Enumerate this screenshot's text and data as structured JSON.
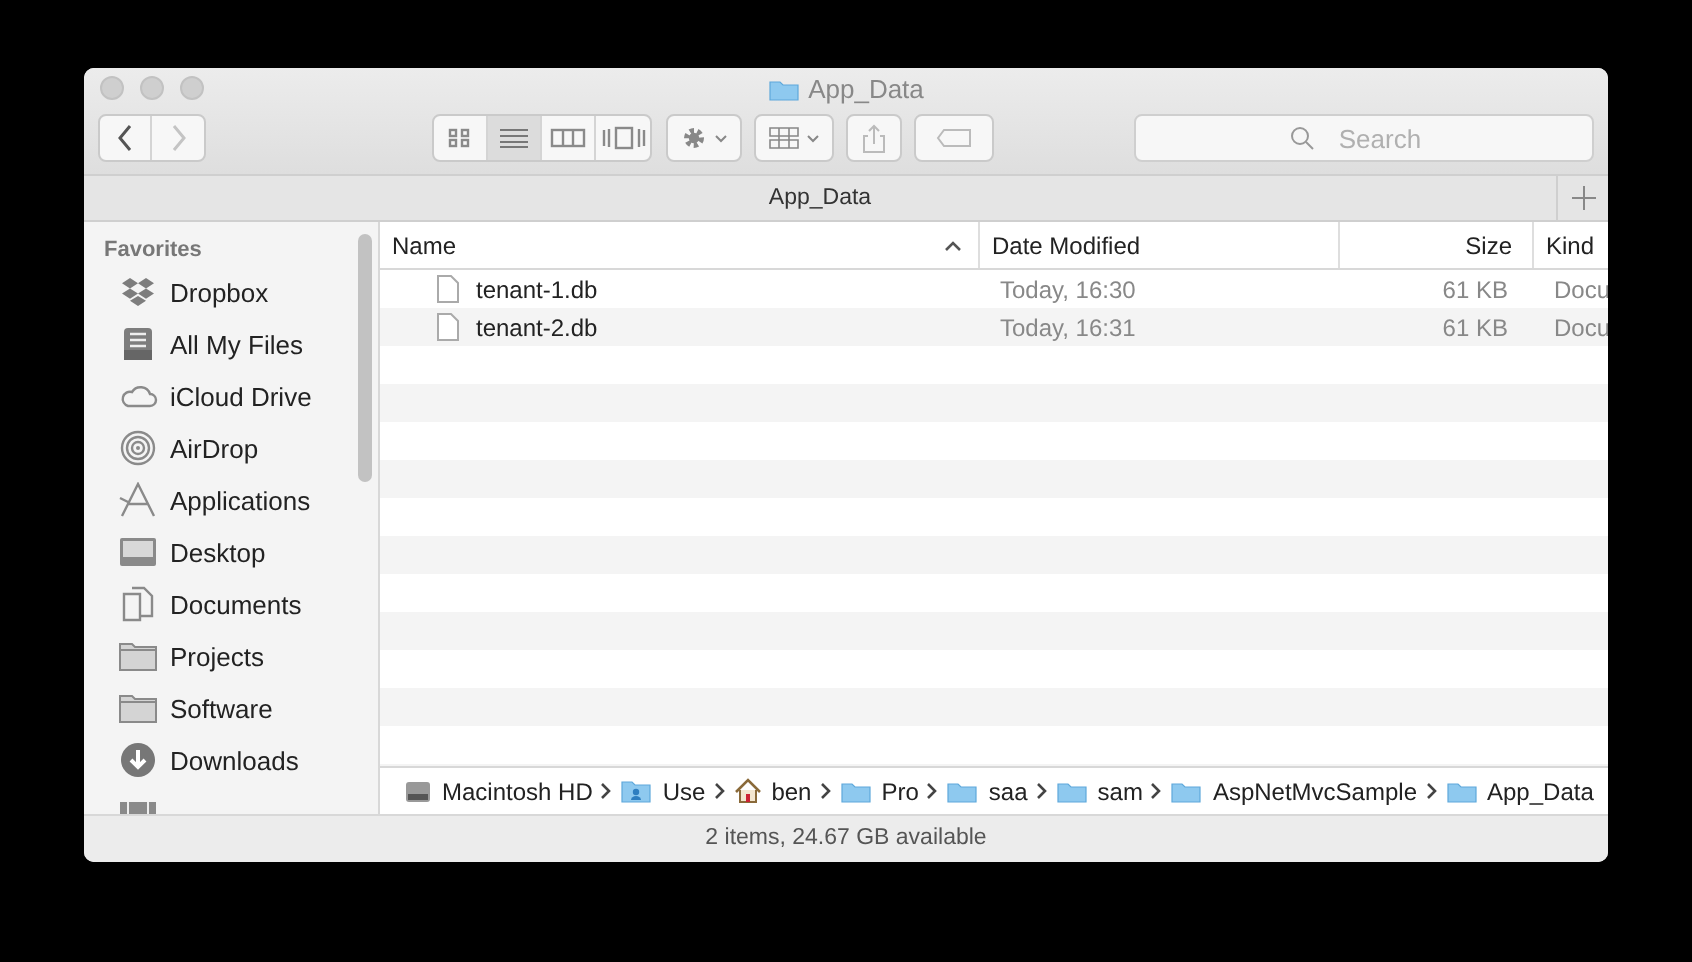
{
  "window": {
    "title": "App_Data"
  },
  "toolbar": {
    "nav": [
      {
        "kind": "back",
        "disabled": false
      },
      {
        "kind": "forward",
        "disabled": true
      }
    ],
    "view_modes": [
      {
        "kind": "icons",
        "selected": false
      },
      {
        "kind": "list",
        "selected": true
      },
      {
        "kind": "columns",
        "selected": false
      },
      {
        "kind": "coverflow",
        "selected": false
      }
    ],
    "search": {
      "placeholder": "Search"
    }
  },
  "tab_bar": {
    "title": "App_Data"
  },
  "sidebar": {
    "heading": "Favorites",
    "items": [
      {
        "label": "Dropbox",
        "kind": "dropbox"
      },
      {
        "label": "All My Files",
        "kind": "allfiles"
      },
      {
        "label": "iCloud Drive",
        "kind": "cloud"
      },
      {
        "label": "AirDrop",
        "kind": "airdrop"
      },
      {
        "label": "Applications",
        "kind": "apps"
      },
      {
        "label": "Desktop",
        "kind": "desktop"
      },
      {
        "label": "Documents",
        "kind": "documents"
      },
      {
        "label": "Projects",
        "kind": "folder"
      },
      {
        "label": "Software",
        "kind": "folder"
      },
      {
        "label": "Downloads",
        "kind": "downloads"
      }
    ]
  },
  "table": {
    "columns": [
      {
        "label": "Name",
        "sorted": true
      },
      {
        "label": "Date Modified",
        "sorted": false
      },
      {
        "label": "Size",
        "sorted": false
      },
      {
        "label": "Kind",
        "sorted": false
      }
    ],
    "rows": [
      {
        "name": "tenant-1.db",
        "date": "Today, 16:30",
        "size": "61 KB",
        "kind": "Docu"
      },
      {
        "name": "tenant-2.db",
        "date": "Today, 16:31",
        "size": "61 KB",
        "kind": "Docu"
      }
    ]
  },
  "path_bar": [
    {
      "label": "Macintosh HD",
      "kind": "disk"
    },
    {
      "label": "Use",
      "kind": "users"
    },
    {
      "label": "ben",
      "kind": "home"
    },
    {
      "label": "Pro",
      "kind": "folder"
    },
    {
      "label": "saa",
      "kind": "folder"
    },
    {
      "label": "sam",
      "kind": "folder"
    },
    {
      "label": "AspNetMvcSample",
      "kind": "folder"
    },
    {
      "label": "App_Data",
      "kind": "folder"
    }
  ],
  "status_bar": "2 items, 24.67 GB available"
}
